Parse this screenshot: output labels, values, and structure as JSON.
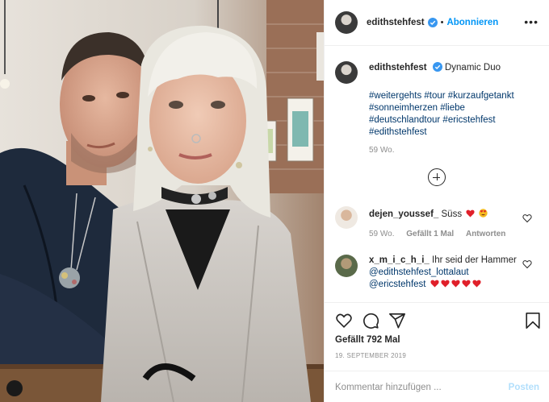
{
  "header": {
    "username": "edithstehfest",
    "separator": "•",
    "follow_label": "Abonnieren",
    "more_label": "•••"
  },
  "caption": {
    "username": "edithstehfest",
    "text": "Dynamic Duo",
    "hashtags": [
      "#weitergehts #tour #kurzaufgetankt",
      "#sonneimherzen #liebe",
      "#deutschlandtour #ericstehfest",
      "#edithstehfest"
    ],
    "time": "59 Wo."
  },
  "comments": [
    {
      "username": "dejen_youssef_",
      "text": "Süss",
      "time": "59 Wo.",
      "likes": "Gefällt 1 Mal",
      "reply_label": "Antworten"
    },
    {
      "username": "x_m_i_c_h_i_",
      "text": "Ihr seid der Hammer",
      "mention1": "@edithstehfest_lottalaut",
      "mention2": "@ericstehfest"
    }
  ],
  "post": {
    "likes": "Gefällt 792 Mal",
    "date": "19. SEPTEMBER 2019"
  },
  "add_comment": {
    "placeholder": "Kommentar hinzufügen ...",
    "post_label": "Posten"
  },
  "colors": {
    "link": "#00376b",
    "follow": "#0095f6",
    "post_disabled": "#b2dffc",
    "verified": "#3897f0",
    "emoji_heart": "#e0202a"
  },
  "icons": [
    "verified-badge-icon",
    "more-icon",
    "plus-circle-icon",
    "heart-icon",
    "comment-icon",
    "share-icon",
    "bookmark-icon"
  ]
}
